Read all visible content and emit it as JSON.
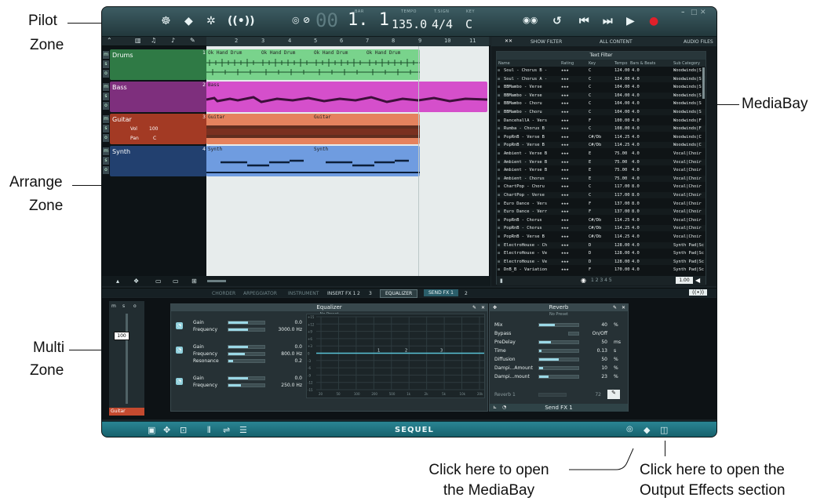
{
  "annotations": {
    "pilot": [
      "Pilot",
      "Zone"
    ],
    "arrange": [
      "Arrange",
      "Zone"
    ],
    "multi": [
      "Multi",
      "Zone"
    ],
    "mediabay": "MediaBay",
    "click_mediabay": [
      "Click here to open",
      "the MediaBay"
    ],
    "click_output": [
      "Click here to open the",
      "Output Effects section"
    ]
  },
  "pilot": {
    "position": "1. 1",
    "tempo": "135.0",
    "signature": "4/4",
    "key": "C",
    "lcd_labels": {
      "bar": "BAR",
      "tempo": "TEMPO",
      "signature": "T.SIGN",
      "key": "KEY"
    },
    "icons": [
      "drum-kit-icon",
      "cube-icon",
      "gear-icon",
      "speaker-icon",
      "power-icon",
      "metronome-icon",
      "rewind-icon",
      "cycle-icon",
      "previous-icon",
      "next-icon",
      "play-icon",
      "record-icon",
      "minimize-icon",
      "maximize-icon",
      "close-icon"
    ]
  },
  "arrange": {
    "ruler": [
      "2",
      "3",
      "4",
      "5",
      "6",
      "7",
      "8",
      "9",
      "10",
      "11"
    ],
    "tracks": [
      {
        "name": "Drums",
        "number": "1",
        "color": "#3fa35a"
      },
      {
        "name": "Bass",
        "number": "2",
        "color": "#9c3a9a"
      },
      {
        "name": "Guitar",
        "number": "3",
        "color": "#c44a2f",
        "vol_label": "Vol",
        "vol": "100",
        "pan_label": "Pan",
        "pan": "C"
      },
      {
        "name": "Synth",
        "number": "4",
        "color": "#2c4e8a"
      }
    ],
    "clips": {
      "drums": [
        "Ok Hand Drum",
        "Ok Hand Drum",
        "Ok Hand Drum",
        "Ok Hand Drum"
      ],
      "bass": [
        "Bass"
      ],
      "guitar": [
        "Guitar",
        "Guitar"
      ],
      "synth": [
        "Synth",
        "Synth"
      ]
    },
    "ms": [
      "m",
      "s",
      "o"
    ]
  },
  "mediabay": {
    "tabs": [
      "SHOW FILTER",
      "ALL CONTENT",
      "AUDIO FILES"
    ],
    "title": "Text Filter",
    "columns": [
      "Name",
      "Rating",
      "Key",
      "Tempo",
      "Bars & Beats",
      "Sub Category"
    ],
    "rows": [
      [
        "Soul - Chorus B -",
        "★★★",
        "C",
        "124.00",
        "4.0",
        "Woodwinds|S"
      ],
      [
        "Soul - Chorus A -",
        "★★★",
        "C",
        "124.00",
        "4.0",
        "Woodwinds|S"
      ],
      [
        "BBMambo - Verse",
        "★★★",
        "C",
        "104.00",
        "4.0",
        "Woodwinds|S"
      ],
      [
        "BBMambo - Verse",
        "★★★",
        "C",
        "104.00",
        "4.0",
        "Woodwinds|S"
      ],
      [
        "BBMambo - Choru",
        "★★★",
        "C",
        "104.00",
        "4.0",
        "Woodwinds|S"
      ],
      [
        "BBMambo - Choru",
        "★★★",
        "C",
        "104.00",
        "4.0",
        "Woodwinds|S"
      ],
      [
        "DancehallA - Vers",
        "★★★",
        "F",
        "100.00",
        "4.0",
        "Woodwinds|F"
      ],
      [
        "Rumba - Chorus B",
        "★★★",
        "C",
        "108.00",
        "4.0",
        "Woodwinds|F"
      ],
      [
        "PopRnB - Verse B",
        "★★★",
        "C#/Db",
        "114.25",
        "4.0",
        "Woodwinds|C"
      ],
      [
        "PopRnB - Verse B",
        "★★★",
        "C#/Db",
        "114.25",
        "4.0",
        "Woodwinds|C"
      ],
      [
        "Ambient - Verse B",
        "★★★",
        "E",
        "75.00",
        "4.0",
        "Vocal|Choir"
      ],
      [
        "Ambient - Verse B",
        "★★★",
        "E",
        "75.00",
        "4.0",
        "Vocal|Choir"
      ],
      [
        "Ambient - Verse B",
        "★★★",
        "E",
        "75.00",
        "4.0",
        "Vocal|Choir"
      ],
      [
        "Ambient - Chorus",
        "★★★",
        "E",
        "75.00",
        "4.0",
        "Vocal|Choir"
      ],
      [
        "ChartPop - Choru",
        "★★★",
        "C",
        "117.00",
        "8.0",
        "Vocal|Choir"
      ],
      [
        "ChartPop - Verse",
        "★★★",
        "C",
        "117.00",
        "8.0",
        "Vocal|Choir"
      ],
      [
        "Euro Dance - Vers",
        "★★★",
        "F",
        "137.00",
        "8.0",
        "Vocal|Choir"
      ],
      [
        "Euro Dance - Verr",
        "★★★",
        "F",
        "137.00",
        "8.0",
        "Vocal|Choir"
      ],
      [
        "PopRnB - Chorus",
        "★★★",
        "C#/Db",
        "114.25",
        "4.0",
        "Vocal|Choir"
      ],
      [
        "PopRnB - Chorus",
        "★★★",
        "C#/Db",
        "114.25",
        "4.0",
        "Vocal|Choir"
      ],
      [
        "PopRnB - Verse B",
        "★★★",
        "C#/Db",
        "114.25",
        "4.0",
        "Vocal|Choir"
      ],
      [
        "ElectroHouse - Ch",
        "★★★",
        "D",
        "128.00",
        "4.0",
        "Synth Pad|Sc"
      ],
      [
        "ElectroHouse - Ve",
        "★★★",
        "D",
        "128.00",
        "4.0",
        "Synth Pad|Sc"
      ],
      [
        "ElectroHouse - Ve",
        "★★★",
        "D",
        "128.00",
        "4.0",
        "Synth Pad|Sc"
      ],
      [
        "DnB_B - Variation",
        "★★★",
        "F",
        "170.00",
        "4.0",
        "Synth Pad|Sc"
      ]
    ],
    "pages": "1  2  3  4  5",
    "zoom": "1.00"
  },
  "zonebar": [
    "CHORDER",
    "ARPEGGIATOR",
    "INSTRUMENT",
    "INSERT FX 1",
    "2",
    "3",
    "EQUALIZER",
    "SEND FX 1",
    "2"
  ],
  "multi": {
    "fader_value": "100",
    "channel": "Guitar",
    "eq": {
      "title": "Equalizer",
      "preset": "No Preset",
      "bands": [
        [
          {
            "label": "Gain",
            "value": "0.0",
            "fill": 0.55
          },
          {
            "label": "Frequency",
            "value": "3000.0 Hz",
            "fill": 0.55
          }
        ],
        [
          {
            "label": "Gain",
            "value": "0.0",
            "fill": 0.55
          },
          {
            "label": "Frequency",
            "value": "800.0 Hz",
            "fill": 0.45
          },
          {
            "label": "Resonance",
            "value": "0.2",
            "fill": 0.12
          }
        ],
        [
          {
            "label": "Gain",
            "value": "0.0",
            "fill": 0.55
          },
          {
            "label": "Frequency",
            "value": "250.0 Hz",
            "fill": 0.35
          }
        ]
      ],
      "db_ticks": [
        "+15",
        "+12",
        "+9",
        "+6",
        "+3",
        "0",
        "-3",
        "-6",
        "-9",
        "-12",
        "-15"
      ],
      "freq_ticks": [
        "20",
        "50",
        "100",
        "200",
        "500",
        "1k",
        "2k",
        "5k",
        "10k",
        "20k"
      ],
      "band_markers": [
        "1",
        "2",
        "3"
      ]
    },
    "reverb": {
      "title": "Reverb",
      "preset": "No Preset",
      "params": [
        {
          "label": "Mix",
          "value": "40",
          "unit": "%",
          "fill": 0.4
        },
        {
          "label": "Bypass",
          "value": "On/Off",
          "unit": "",
          "fill": 0
        },
        {
          "label": "PreDelay",
          "value": "50",
          "unit": "ms",
          "fill": 0.3
        },
        {
          "label": "Time",
          "value": "0.13",
          "unit": "s",
          "fill": 0.05
        },
        {
          "label": "Diffusion",
          "value": "50",
          "unit": "%",
          "fill": 0.5
        },
        {
          "label": "Dampi...Amount",
          "value": "10",
          "unit": "%",
          "fill": 0.1
        },
        {
          "label": "Dampi...mount",
          "value": "23",
          "unit": "%",
          "fill": 0.23
        }
      ],
      "reverb_label": "Reverb 1",
      "reverb_value": "72",
      "send": "Send FX 1"
    }
  },
  "bottom": {
    "brand": "SEQUEL"
  }
}
